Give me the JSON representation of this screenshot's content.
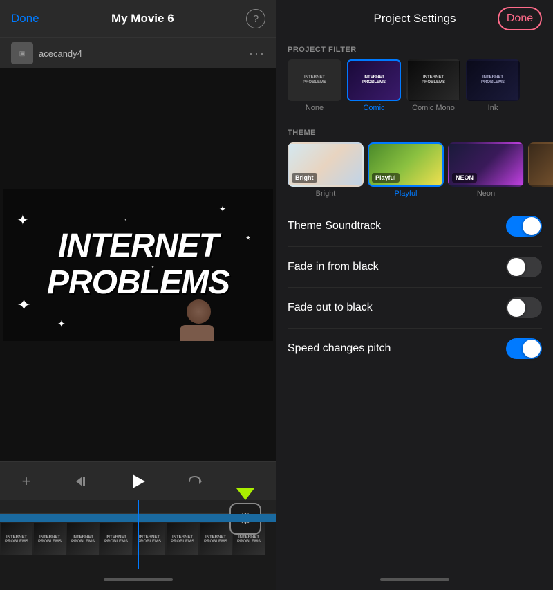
{
  "left": {
    "done_label": "Done",
    "title": "My Movie 6",
    "help_icon": "?",
    "username": "acecandy4",
    "dots": "···",
    "preview": {
      "line1": "INTERNET",
      "line2": "PROBLEMS"
    },
    "controls": {
      "rewind_icon": "⏮",
      "play_icon": "▶",
      "redo_icon": "↩",
      "add_icon": "+"
    },
    "settings_icon": "⚙",
    "home_bar": ""
  },
  "right": {
    "title": "Project Settings",
    "done_label": "Done",
    "sections": {
      "filter": {
        "label": "PROJECT FILTER",
        "items": [
          {
            "id": "none",
            "label": "None",
            "active": false
          },
          {
            "id": "comic",
            "label": "Comic",
            "active": true
          },
          {
            "id": "comicmono",
            "label": "Comic Mono",
            "active": false
          },
          {
            "id": "ink",
            "label": "Ink",
            "active": false
          }
        ]
      },
      "theme": {
        "label": "THEME",
        "items": [
          {
            "id": "bright",
            "label": "Bright",
            "overlay": "Bright",
            "active": false
          },
          {
            "id": "playful",
            "label": "Playful",
            "overlay": "Playful",
            "active": true
          },
          {
            "id": "neon",
            "label": "Neon",
            "overlay": "NEON",
            "active": false
          },
          {
            "id": "fourth",
            "label": "",
            "overlay": "",
            "active": false
          }
        ]
      }
    },
    "toggles": [
      {
        "id": "theme-soundtrack",
        "label": "Theme Soundtrack",
        "on": true
      },
      {
        "id": "fade-in",
        "label": "Fade in from black",
        "on": false
      },
      {
        "id": "fade-out",
        "label": "Fade out to black",
        "on": false
      },
      {
        "id": "speed-pitch",
        "label": "Speed changes pitch",
        "on": true
      }
    ]
  }
}
